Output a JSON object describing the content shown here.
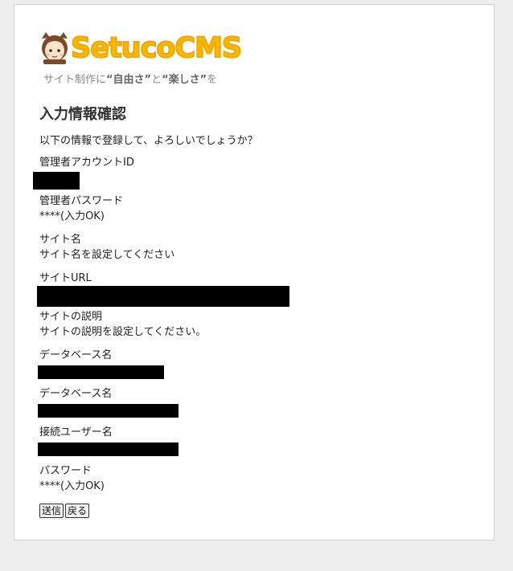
{
  "logo": {
    "text": "SetucoCMS",
    "mascot_icon": "girl-face-icon",
    "color": "#f5b800"
  },
  "tagline": {
    "prefix": "サイト制作に",
    "q1": "“自由さ”",
    "mid": "と",
    "q2": "“楽しさ”",
    "suffix": "を"
  },
  "page_title": "入力情報確認",
  "intro": "以下の情報で登録して、よろしいでしょうか？",
  "fields": [
    {
      "label": "管理者アカウントID",
      "value": ""
    },
    {
      "label": "管理者パスワード",
      "value": "****(入力OK)"
    },
    {
      "label": "サイト名",
      "value": "サイト名を設定してください"
    },
    {
      "label": "サイトURL",
      "value": ""
    },
    {
      "label": "サイトの説明",
      "value": "サイトの説明を設定してください。"
    },
    {
      "label": "データベース名",
      "value": ""
    },
    {
      "label": "データベース名",
      "value": ""
    },
    {
      "label": "接続ユーザー名",
      "value": ""
    },
    {
      "label": "パスワード",
      "value": "****(入力OK)"
    }
  ],
  "buttons": {
    "submit": "送信",
    "back": "戻る"
  }
}
